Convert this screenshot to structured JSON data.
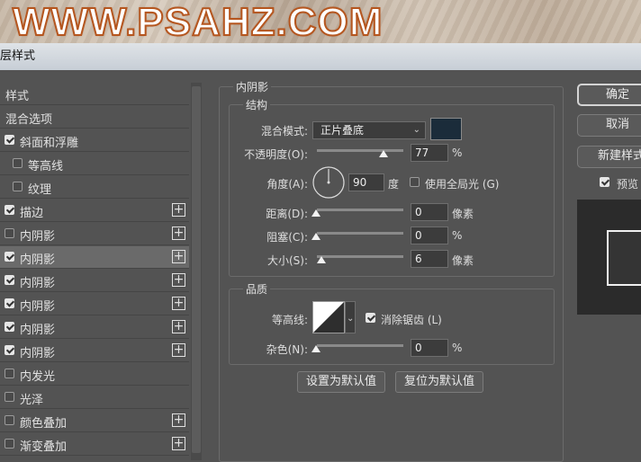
{
  "banner": {
    "text": "WWW.PSAHZ.COM"
  },
  "window": {
    "title": "图层样式"
  },
  "title_visible": "层样式",
  "styles_list": [
    {
      "label": "样式",
      "checkbox": false,
      "checked": false,
      "plus": false,
      "selected": false
    },
    {
      "label": "混合选项",
      "checkbox": false,
      "checked": false,
      "plus": false,
      "selected": false
    },
    {
      "label": "斜面和浮雕",
      "checkbox": true,
      "checked": true,
      "plus": false,
      "selected": false
    },
    {
      "label": "等高线",
      "checkbox": true,
      "checked": false,
      "plus": false,
      "selected": false,
      "indent": true
    },
    {
      "label": "纹理",
      "checkbox": true,
      "checked": false,
      "plus": false,
      "selected": false,
      "indent": true
    },
    {
      "label": "描边",
      "checkbox": true,
      "checked": true,
      "plus": true,
      "selected": false
    },
    {
      "label": "内阴影",
      "checkbox": true,
      "checked": false,
      "plus": true,
      "selected": false
    },
    {
      "label": "内阴影",
      "checkbox": true,
      "checked": true,
      "plus": true,
      "selected": true
    },
    {
      "label": "内阴影",
      "checkbox": true,
      "checked": true,
      "plus": true,
      "selected": false
    },
    {
      "label": "内阴影",
      "checkbox": true,
      "checked": true,
      "plus": true,
      "selected": false
    },
    {
      "label": "内阴影",
      "checkbox": true,
      "checked": true,
      "plus": true,
      "selected": false
    },
    {
      "label": "内阴影",
      "checkbox": true,
      "checked": true,
      "plus": true,
      "selected": false
    },
    {
      "label": "内发光",
      "checkbox": true,
      "checked": false,
      "plus": false,
      "selected": false
    },
    {
      "label": "光泽",
      "checkbox": true,
      "checked": false,
      "plus": false,
      "selected": false
    },
    {
      "label": "颜色叠加",
      "checkbox": true,
      "checked": false,
      "plus": true,
      "selected": false
    },
    {
      "label": "渐变叠加",
      "checkbox": true,
      "checked": false,
      "plus": true,
      "selected": false
    }
  ],
  "panel": {
    "title": "内阴影",
    "structure": {
      "legend": "结构",
      "blend_mode_label": "混合模式:",
      "blend_mode_value": "正片叠底",
      "shadow_color": "#1b2c3a",
      "opacity_label": "不透明度(O):",
      "opacity_value": "77",
      "opacity_unit": "%",
      "opacity_level": 0.77,
      "angle_label": "角度(A):",
      "angle_value": "90",
      "angle_unit": "度",
      "global_light_label": "使用全局光 (G)",
      "global_light_checked": false,
      "distance_label": "距离(D):",
      "distance_value": "0",
      "distance_unit": "像素",
      "choke_label": "阻塞(C):",
      "choke_value": "0",
      "choke_unit": "%",
      "size_label": "大小(S):",
      "size_value": "6",
      "size_unit": "像素"
    },
    "quality": {
      "legend": "品质",
      "contour_label": "等高线:",
      "antialias_label": "消除锯齿 (L)",
      "antialias_checked": true,
      "noise_label": "杂色(N):",
      "noise_value": "0",
      "noise_unit": "%"
    },
    "make_default_label": "设置为默认值",
    "reset_default_label": "复位为默认值"
  },
  "right": {
    "ok_label": "确定",
    "cancel_label": "取消",
    "new_style_label": "新建样式...",
    "preview_label": "预览",
    "preview_checked": true
  },
  "icons": {
    "plus": "plus-square-icon",
    "dropdown": "chevron-down-icon",
    "angle": "angle-dial-icon",
    "contour": "contour-curve-icon",
    "slider": "slider-triangle-icon"
  }
}
